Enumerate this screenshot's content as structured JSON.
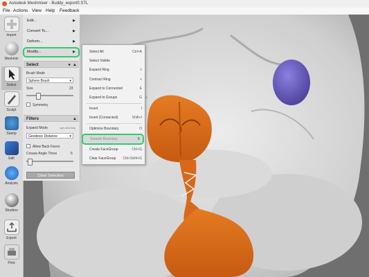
{
  "window": {
    "title": "Autodesk Meshmixer - Buddy_export0.STL"
  },
  "menubar": [
    "File",
    "Actions",
    "View",
    "Help",
    "Feedback"
  ],
  "toolbar": [
    {
      "label": "Import",
      "icon": "plus-icon"
    },
    {
      "label": "Meshmix",
      "icon": "sphere-icon"
    },
    {
      "label": "Select",
      "icon": "select-arrow-icon"
    },
    {
      "label": "Sculpt",
      "icon": "brush-icon"
    },
    {
      "label": "Stamp",
      "icon": "stamp-icon"
    },
    {
      "label": "Edit",
      "icon": "edit-icon"
    },
    {
      "label": "Analysis",
      "icon": "analysis-icon"
    },
    {
      "label": "Shaders",
      "icon": "shader-sphere-icon"
    },
    {
      "label": "Export",
      "icon": "export-icon"
    },
    {
      "label": "Print",
      "icon": "print-icon"
    }
  ],
  "panel": {
    "menu_items": [
      "Edit...",
      "Convert To...",
      "Deform...",
      "Modify..."
    ],
    "select_header": "Select",
    "brush_mode_label": "Brush Mode",
    "brush_mode_value": "Sphere Brush",
    "size_label": "Size",
    "size_value": "23",
    "symmetry_label": "Symmetry",
    "filters_header": "Filters",
    "expand_mode_label": "Expand Mode",
    "expand_mode_hint": "right-click/drag",
    "expand_mode_value": "Geodesic Distance",
    "allow_back_faces_label": "Allow Back Faces",
    "crease_angle_label": "Crease Angle Thres",
    "crease_angle_value": "6",
    "clear_selection_label": "Clear Selection"
  },
  "submenu": [
    {
      "label": "Select All",
      "shortcut": "Ctrl+A"
    },
    {
      "label": "Select Visible",
      "shortcut": ""
    },
    {
      "label": "Expand Ring",
      "shortcut": ">"
    },
    {
      "label": "Contract Ring",
      "shortcut": "<"
    },
    {
      "label": "Expand to Connected",
      "shortcut": "E"
    },
    {
      "label": "Expand to Groups",
      "shortcut": "G"
    },
    {
      "label": "Invert",
      "shortcut": "I"
    },
    {
      "label": "Invert (Connected)",
      "shortcut": "Shift+I"
    },
    {
      "label": "Optimize Boundary",
      "shortcut": "O"
    },
    {
      "label": "Smooth Boundary",
      "shortcut": "B"
    },
    {
      "label": "Create FaceGroup",
      "shortcut": "Ctrl+G"
    },
    {
      "label": "Clear FaceGroup",
      "shortcut": "Ctrl+Shift+G"
    }
  ],
  "colors": {
    "selection_orange": "#d9691a",
    "highlight_green": "#2ecc71",
    "mesh_gray": "#d4d4d4",
    "sphere_purple": "#6c5fc7"
  }
}
